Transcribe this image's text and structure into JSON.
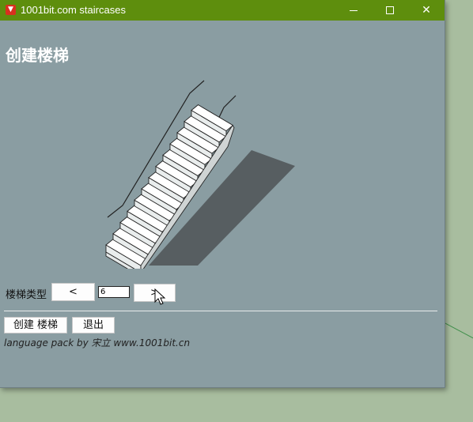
{
  "window": {
    "title": "1001bit.com staircases",
    "app_icon": "sketchup-icon",
    "controls": {
      "minimize": "minimize-icon",
      "maximize": "maximize-icon",
      "close_glyph": "✕"
    }
  },
  "dialog": {
    "heading": "创建楼梯",
    "preview": "straight-staircase-preview",
    "stair_type": {
      "label": "楼梯类型",
      "prev_label": "<",
      "value": "6",
      "next_label": ">"
    },
    "buttons": {
      "create_label": "创建 楼梯",
      "exit_label": "退出"
    },
    "credit": "language pack by 宋立 www.1001bit.cn"
  },
  "colors": {
    "titlebar": "#5e8e0d",
    "dialog_bg": "#8a9da2",
    "desktop_bg": "#a8bd9f"
  }
}
